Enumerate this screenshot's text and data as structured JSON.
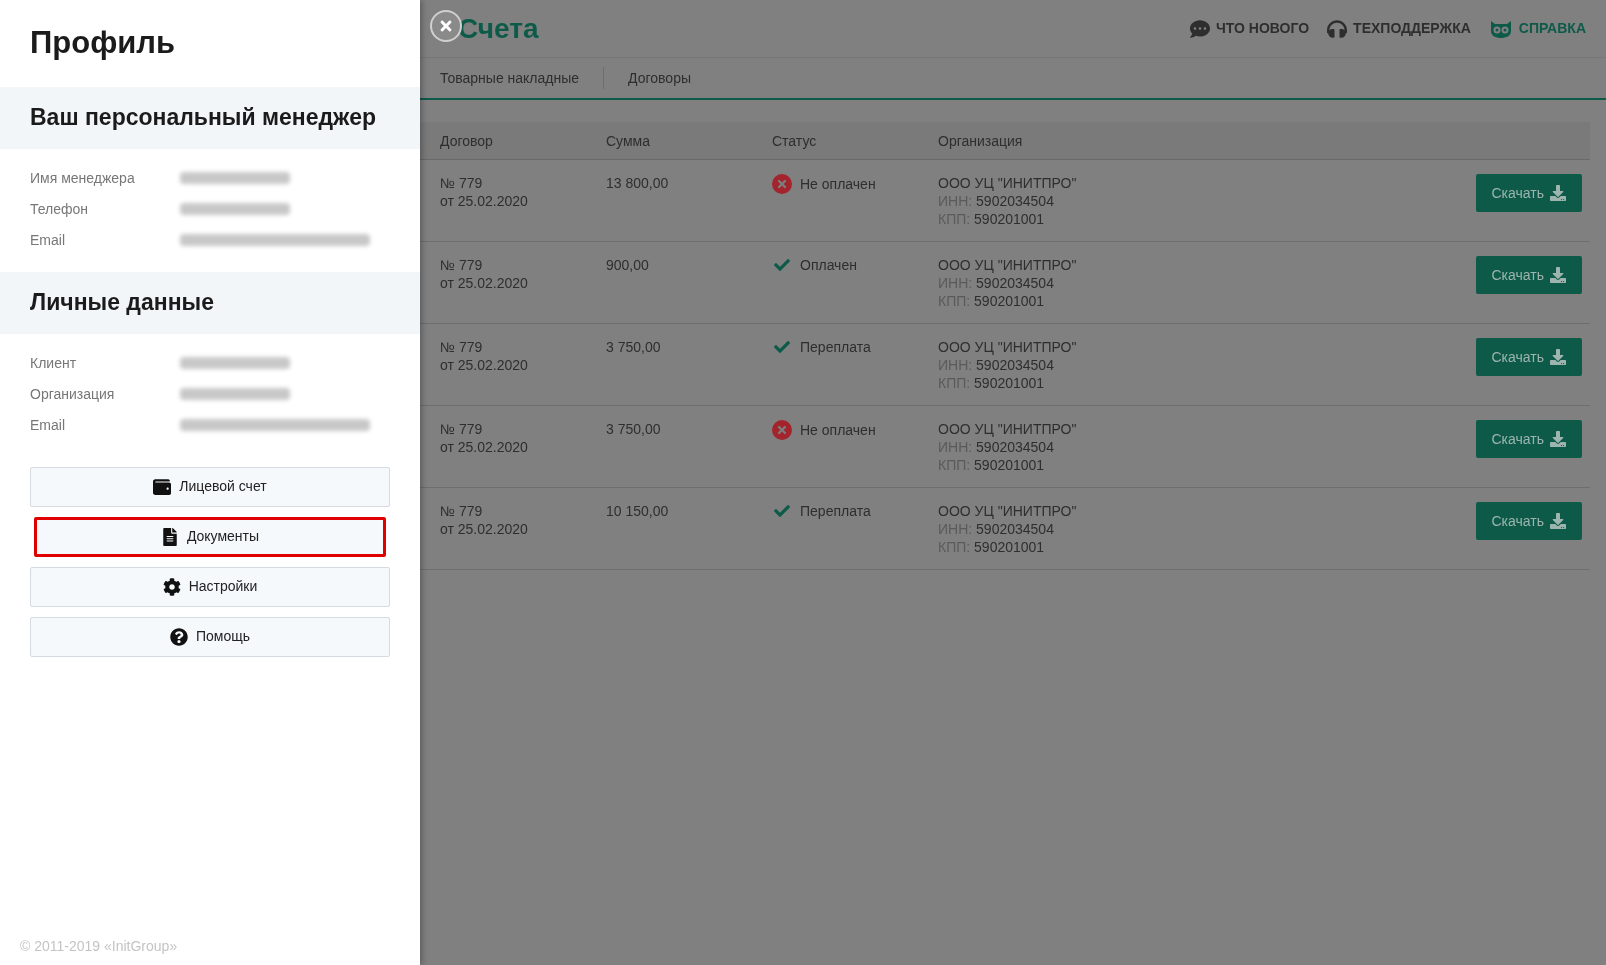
{
  "page": {
    "title": "Счета",
    "top_links": [
      {
        "kind": "news",
        "label": "ЧТО НОВОГО"
      },
      {
        "kind": "support",
        "label": "ТЕХПОДДЕРЖКА"
      },
      {
        "kind": "help",
        "label": "СПРАВКА"
      }
    ],
    "tabs": [
      "Товарные накладные",
      "Договоры"
    ],
    "table": {
      "columns": [
        "Договор",
        "Сумма",
        "Статус",
        "Организация"
      ],
      "rows": [
        {
          "number": "№ 779",
          "date_prefix": "от",
          "date": "25.02.2020",
          "sum": "13 800,00",
          "kind": "unpaid",
          "status": "Не оплачен",
          "org": "ООО УЦ \"ИНИТПРО\"",
          "inn_label": "ИНН:",
          "inn": "5902034504",
          "kpp_label": "КПП:",
          "kpp": "590201001",
          "action": "Скачать"
        },
        {
          "number": "№ 779",
          "date_prefix": "от",
          "date": "25.02.2020",
          "sum": "900,00",
          "kind": "paid",
          "status": "Оплачен",
          "org": "ООО УЦ \"ИНИТПРО\"",
          "inn_label": "ИНН:",
          "inn": "5902034504",
          "kpp_label": "КПП:",
          "kpp": "590201001",
          "action": "Скачать"
        },
        {
          "number": "№ 779",
          "date_prefix": "от",
          "date": "25.02.2020",
          "sum": "3 750,00",
          "kind": "paid",
          "status": "Переплата",
          "org": "ООО УЦ \"ИНИТПРО\"",
          "inn_label": "ИНН:",
          "inn": "5902034504",
          "kpp_label": "КПП:",
          "kpp": "590201001",
          "action": "Скачать"
        },
        {
          "number": "№ 779",
          "date_prefix": "от",
          "date": "25.02.2020",
          "sum": "3 750,00",
          "kind": "unpaid",
          "status": "Не оплачен",
          "org": "ООО УЦ \"ИНИТПРО\"",
          "inn_label": "ИНН:",
          "inn": "5902034504",
          "kpp_label": "КПП:",
          "kpp": "590201001",
          "action": "Скачать"
        },
        {
          "number": "№ 779",
          "date_prefix": "от",
          "date": "25.02.2020",
          "sum": "10 150,00",
          "kind": "paid",
          "status": "Переплата",
          "org": "ООО УЦ \"ИНИТПРО\"",
          "inn_label": "ИНН:",
          "inn": "5902034504",
          "kpp_label": "КПП:",
          "kpp": "590201001",
          "action": "Скачать"
        }
      ]
    }
  },
  "drawer": {
    "title": "Профиль",
    "sections": [
      {
        "heading": "Ваш персональный менеджер",
        "fields": [
          "Имя менеджера",
          "Телефон",
          "Email"
        ]
      },
      {
        "heading": "Личные данные",
        "fields": [
          "Клиент",
          "Организация",
          "Email"
        ]
      }
    ],
    "menu": [
      {
        "kind": "wallet",
        "label": "Лицевой счет",
        "highlighted": false
      },
      {
        "kind": "document",
        "label": "Документы",
        "highlighted": true
      },
      {
        "kind": "settings",
        "label": "Настройки",
        "highlighted": false
      },
      {
        "kind": "help",
        "label": "Помощь",
        "highlighted": false
      }
    ],
    "footer": "© 2011-2019 «InitGroup»"
  }
}
